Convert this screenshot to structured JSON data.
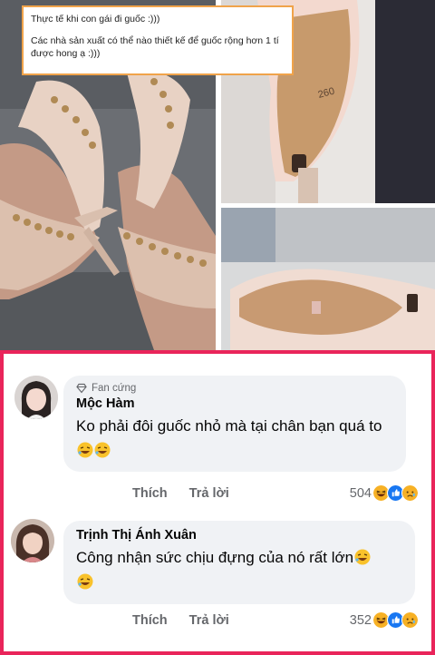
{
  "post": {
    "caption_line1": "Thực tế khi con gái đi guốc :)))",
    "caption_line2": "Các nhà sản xuất có thể nào thiết kế để guốc rộng hơn 1 tí được hong ạ :)))",
    "shoe_size_label": "260",
    "colors": {
      "caption_border": "#f0a34a",
      "frame": "#e9245a"
    }
  },
  "comments": [
    {
      "badge": "Fan cứng",
      "badge_icon": "diamond-icon",
      "author": "Mộc Hàm",
      "text": "Ko phải đôi guốc nhỏ mà tại chân bạn quá to",
      "emojis": [
        "rofl-emoji",
        "rofl-emoji"
      ],
      "like_label": "Thích",
      "reply_label": "Trả lời",
      "reaction_count": "504",
      "reaction_icons": [
        "haha-icon",
        "like-icon",
        "sad-icon"
      ]
    },
    {
      "author": "Trịnh Thị Ánh Xuân",
      "text": "Công nhận sức chịu đựng của nó rất lớn",
      "emojis": [
        "rofl-emoji",
        "rofl-emoji"
      ],
      "like_label": "Thích",
      "reply_label": "Trả lời",
      "reaction_count": "352",
      "reaction_icons": [
        "haha-icon",
        "like-icon",
        "sad-icon"
      ]
    }
  ]
}
